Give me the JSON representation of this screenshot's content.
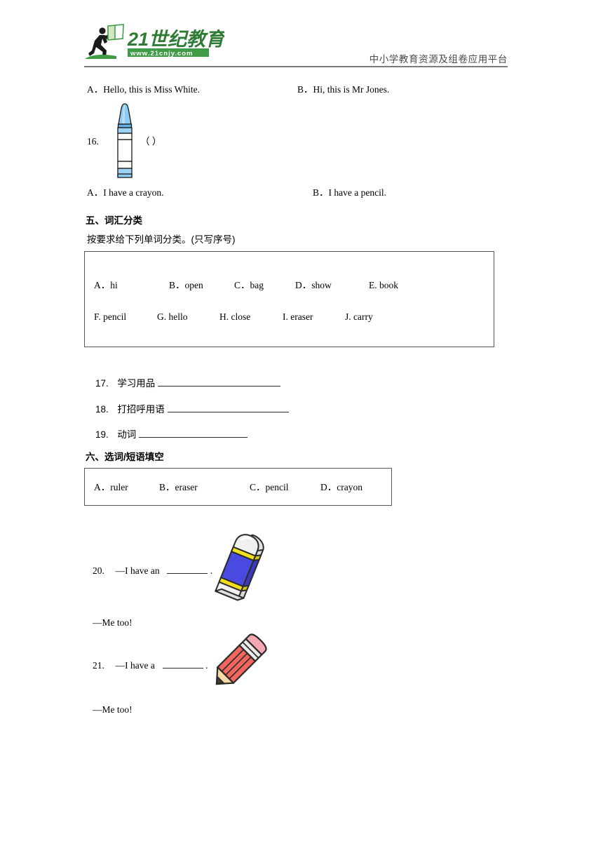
{
  "header": {
    "logo_text_main": "21世纪教育",
    "logo_text_url": "www.21cnjy.com",
    "tagline": "中小学教育资源及组卷应用平台"
  },
  "q15_options": {
    "option_a": "A．Hello, this is Miss White.",
    "option_b": "B．Hi, this is Mr Jones."
  },
  "q16": {
    "number": "16.",
    "answer_bracket": "（ ）",
    "image_name": "crayon-illustration",
    "option_a": "A．I have a crayon.",
    "option_b": "B．I have a pencil."
  },
  "section_five": {
    "heading": "五、词汇分类",
    "instruction": "按要求给下列单词分类。(只写序号)",
    "wordbank_row1": [
      "A．hi",
      "B．open",
      "C．bag",
      "D．show",
      "E. book"
    ],
    "wordbank_row2": [
      "F. pencil",
      "G. hello",
      "H. close",
      "I. eraser",
      "J. carry"
    ],
    "questions": [
      {
        "number": "17.",
        "label": "学习用品"
      },
      {
        "number": "18.",
        "label": "打招呼用语"
      },
      {
        "number": "19.",
        "label": "动词"
      }
    ]
  },
  "section_six": {
    "heading": "六、选词/短语填空",
    "wordbank": [
      "A．ruler",
      "B．eraser",
      "C．pencil",
      "D．crayon"
    ],
    "questions": [
      {
        "number": "20.",
        "prompt_before": "—I have an",
        "prompt_after": ".",
        "reply": "—Me too!",
        "image_name": "eraser-illustration"
      },
      {
        "number": "21.",
        "prompt_before": "—I have a",
        "prompt_after": ".",
        "reply": "—Me too!",
        "image_name": "pencil-illustration"
      }
    ]
  },
  "colors": {
    "logo_green": "#3f9b46",
    "logo_dark_green": "#2f7a35",
    "crayon_blue": "#8ecbf2",
    "crayon_blue_dark": "#5fb3e8",
    "eraser_blue": "#4040d8",
    "eraser_yellow": "#f2e01c",
    "eraser_white": "#eeeeee",
    "pencil_red": "#f2665e",
    "pencil_pink": "#f5a8b0",
    "pencil_wood": "#f7d9a8",
    "rule_gray": "#7a7a7a",
    "box_border": "#585858"
  }
}
